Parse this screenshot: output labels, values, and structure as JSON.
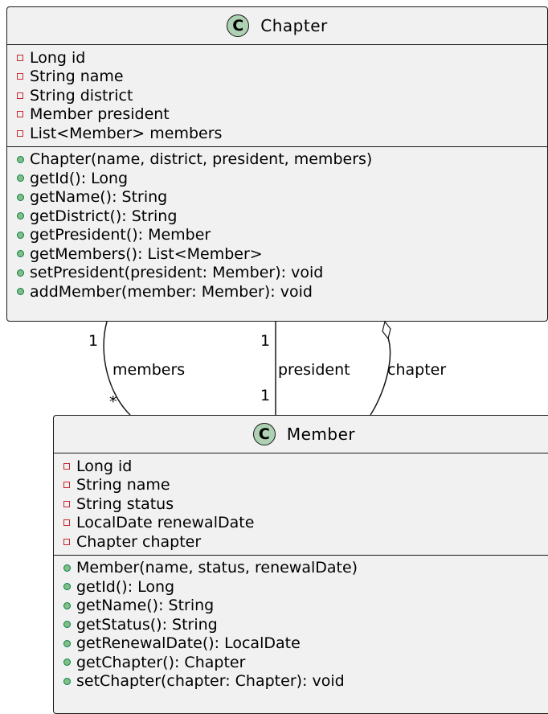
{
  "classes": {
    "chapter": {
      "icon": "class-stereotype-c-icon",
      "stereotype": "C",
      "name": "Chapter",
      "fields": [
        "Long id",
        "String name",
        "String district",
        "Member president",
        "List<Member> members"
      ],
      "methods": [
        "Chapter(name, district, president, members)",
        "getId(): Long",
        "getName(): String",
        "getDistrict(): String",
        "getPresident(): Member",
        "getMembers(): List<Member>",
        "setPresident(president: Member): void",
        "addMember(member: Member): void"
      ]
    },
    "member": {
      "icon": "class-stereotype-c-icon",
      "stereotype": "C",
      "name": "Member",
      "fields": [
        "Long id",
        "String name",
        "String status",
        "LocalDate renewalDate",
        "Chapter chapter"
      ],
      "methods": [
        "Member(name, status, renewalDate)",
        "getId(): Long",
        "getName(): String",
        "getStatus(): String",
        "getRenewalDate(): LocalDate",
        "getChapter(): Chapter",
        "setChapter(chapter: Chapter): void"
      ]
    }
  },
  "relations": {
    "members": {
      "label": "members",
      "source_mult": "1",
      "target_mult": "*"
    },
    "president": {
      "label": "president",
      "source_mult": "1",
      "target_mult": "1"
    },
    "chapter": {
      "label": "chapter"
    }
  },
  "colors": {
    "class_fill": "#f1f1f1",
    "border": "#181818",
    "stereotype_fill": "#add1b2",
    "private_marker": "#c82930",
    "public_marker": "#84be84"
  }
}
